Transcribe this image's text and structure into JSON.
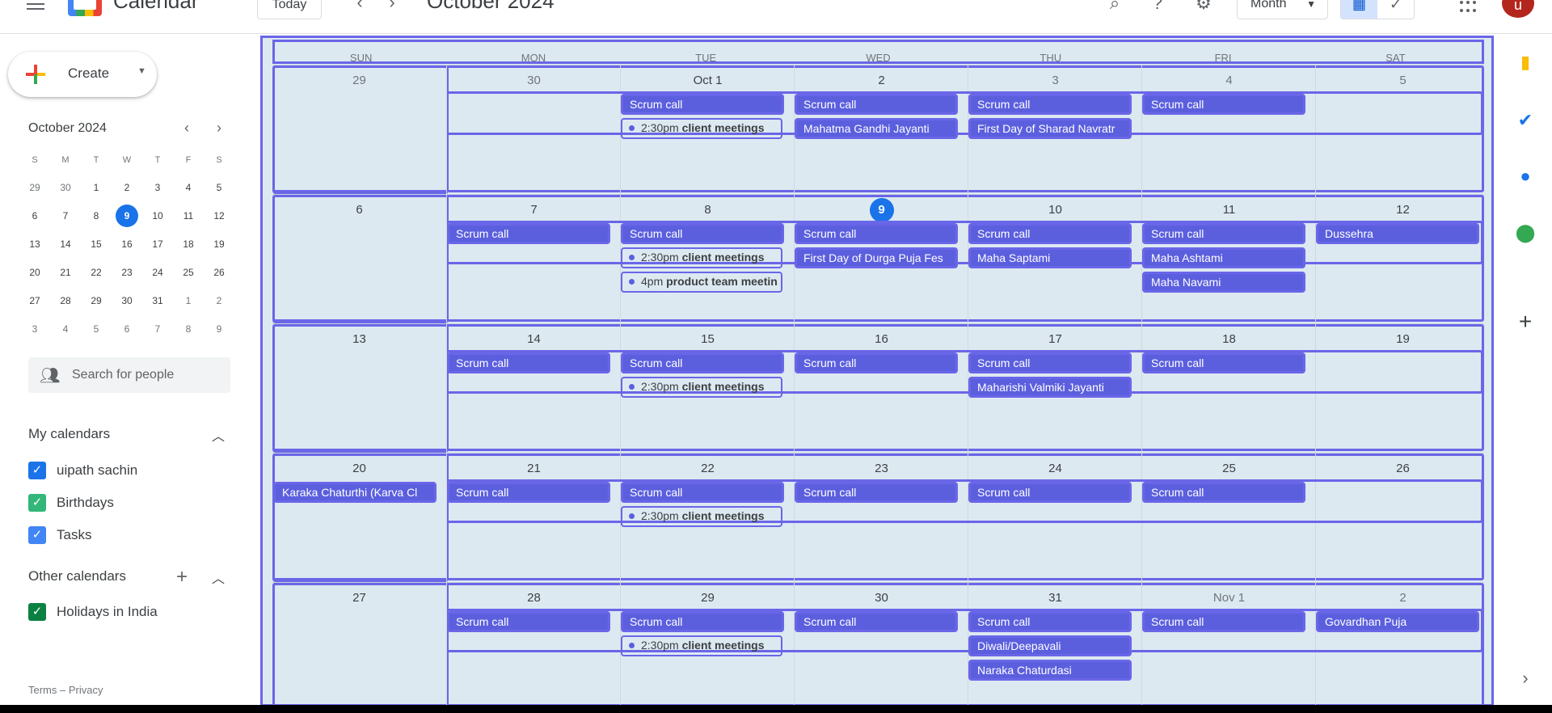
{
  "app": {
    "title": "Calendar"
  },
  "header": {
    "today_label": "Today",
    "month_title": "October 2024",
    "view_select": "Month",
    "avatar_letter": "u"
  },
  "sidebar": {
    "create_label": "Create",
    "mini_calendar": {
      "title": "October 2024",
      "weekday_initials": [
        "S",
        "M",
        "T",
        "W",
        "T",
        "F",
        "S"
      ],
      "weeks": [
        [
          "29",
          "30",
          "1",
          "2",
          "3",
          "4",
          "5"
        ],
        [
          "6",
          "7",
          "8",
          "9",
          "10",
          "11",
          "12"
        ],
        [
          "13",
          "14",
          "15",
          "16",
          "17",
          "18",
          "19"
        ],
        [
          "20",
          "21",
          "22",
          "23",
          "24",
          "25",
          "26"
        ],
        [
          "27",
          "28",
          "29",
          "30",
          "31",
          "1",
          "2"
        ],
        [
          "3",
          "4",
          "5",
          "6",
          "7",
          "8",
          "9"
        ]
      ],
      "today": "9"
    },
    "search_people_placeholder": "Search for people",
    "my_calendars_title": "My calendars",
    "my_calendars": [
      {
        "label": "uipath sachin",
        "color": "#1a73e8"
      },
      {
        "label": "Birthdays",
        "color": "#33b679"
      },
      {
        "label": "Tasks",
        "color": "#4285f4"
      }
    ],
    "other_calendars_title": "Other calendars",
    "other_calendars": [
      {
        "label": "Holidays in India",
        "color": "#0b8043"
      }
    ],
    "footer": "Terms – Privacy"
  },
  "grid": {
    "weekday_headers": [
      "SUN",
      "MON",
      "TUE",
      "WED",
      "THU",
      "FRI",
      "SAT"
    ],
    "event_color": "#5b5fde",
    "weeks": [
      {
        "days": [
          "29",
          "30",
          "Oct 1",
          "2",
          "3",
          "4",
          "5"
        ],
        "gray": [
          0,
          1,
          4,
          5,
          6
        ],
        "events": [
          {
            "col": 2,
            "row": 0,
            "text": "Scrum call",
            "kind": "pill"
          },
          {
            "col": 3,
            "row": 0,
            "text": "Scrum call",
            "kind": "pill"
          },
          {
            "col": 4,
            "row": 0,
            "text": "Scrum call",
            "kind": "pill"
          },
          {
            "col": 5,
            "row": 0,
            "text": "Scrum call",
            "kind": "pill"
          },
          {
            "col": 2,
            "row": 1,
            "time": "2:30pm",
            "title": "client meetings",
            "kind": "timed"
          },
          {
            "col": 3,
            "row": 1,
            "text": "Mahatma Gandhi Jayanti",
            "kind": "pill"
          },
          {
            "col": 4,
            "row": 1,
            "text": "First Day of Sharad Navratr",
            "kind": "pill"
          }
        ]
      },
      {
        "days": [
          "6",
          "7",
          "8",
          "9",
          "10",
          "11",
          "12"
        ],
        "today_col": 3,
        "events": [
          {
            "col": 1,
            "row": 0,
            "text": "Scrum call",
            "kind": "pill"
          },
          {
            "col": 2,
            "row": 0,
            "text": "Scrum call",
            "kind": "pill"
          },
          {
            "col": 3,
            "row": 0,
            "text": "Scrum call",
            "kind": "pill"
          },
          {
            "col": 4,
            "row": 0,
            "text": "Scrum call",
            "kind": "pill"
          },
          {
            "col": 5,
            "row": 0,
            "text": "Scrum call",
            "kind": "pill"
          },
          {
            "col": 6,
            "row": 0,
            "text": "Dussehra",
            "kind": "pill"
          },
          {
            "col": 2,
            "row": 1,
            "time": "2:30pm",
            "title": "client meetings",
            "kind": "timed"
          },
          {
            "col": 3,
            "row": 1,
            "text": "First Day of Durga Puja Fes",
            "kind": "pill"
          },
          {
            "col": 4,
            "row": 1,
            "text": "Maha Saptami",
            "kind": "pill"
          },
          {
            "col": 5,
            "row": 1,
            "text": "Maha Ashtami",
            "kind": "pill"
          },
          {
            "col": 2,
            "row": 2,
            "time": "4pm",
            "title": "product team meetin",
            "kind": "timed"
          },
          {
            "col": 5,
            "row": 2,
            "text": "Maha Navami",
            "kind": "pill"
          }
        ]
      },
      {
        "days": [
          "13",
          "14",
          "15",
          "16",
          "17",
          "18",
          "19"
        ],
        "events": [
          {
            "col": 1,
            "row": 0,
            "text": "Scrum call",
            "kind": "pill"
          },
          {
            "col": 2,
            "row": 0,
            "text": "Scrum call",
            "kind": "pill"
          },
          {
            "col": 3,
            "row": 0,
            "text": "Scrum call",
            "kind": "pill"
          },
          {
            "col": 4,
            "row": 0,
            "text": "Scrum call",
            "kind": "pill"
          },
          {
            "col": 5,
            "row": 0,
            "text": "Scrum call",
            "kind": "pill"
          },
          {
            "col": 2,
            "row": 1,
            "time": "2:30pm",
            "title": "client meetings",
            "kind": "timed"
          },
          {
            "col": 4,
            "row": 1,
            "text": "Maharishi Valmiki Jayanti",
            "kind": "pill"
          }
        ]
      },
      {
        "days": [
          "20",
          "21",
          "22",
          "23",
          "24",
          "25",
          "26"
        ],
        "events": [
          {
            "col": 0,
            "row": 0,
            "text": "Karaka Chaturthi (Karva Cl",
            "kind": "pill"
          },
          {
            "col": 1,
            "row": 0,
            "text": "Scrum call",
            "kind": "pill"
          },
          {
            "col": 2,
            "row": 0,
            "text": "Scrum call",
            "kind": "pill"
          },
          {
            "col": 3,
            "row": 0,
            "text": "Scrum call",
            "kind": "pill"
          },
          {
            "col": 4,
            "row": 0,
            "text": "Scrum call",
            "kind": "pill"
          },
          {
            "col": 5,
            "row": 0,
            "text": "Scrum call",
            "kind": "pill"
          },
          {
            "col": 2,
            "row": 1,
            "time": "2:30pm",
            "title": "client meetings",
            "kind": "timed"
          }
        ]
      },
      {
        "days": [
          "27",
          "28",
          "29",
          "30",
          "31",
          "Nov 1",
          "2"
        ],
        "gray": [
          5,
          6
        ],
        "events": [
          {
            "col": 1,
            "row": 0,
            "text": "Scrum call",
            "kind": "pill"
          },
          {
            "col": 2,
            "row": 0,
            "text": "Scrum call",
            "kind": "pill"
          },
          {
            "col": 3,
            "row": 0,
            "text": "Scrum call",
            "kind": "pill"
          },
          {
            "col": 4,
            "row": 0,
            "text": "Scrum call",
            "kind": "pill"
          },
          {
            "col": 5,
            "row": 0,
            "text": "Scrum call",
            "kind": "pill"
          },
          {
            "col": 6,
            "row": 0,
            "text": "Govardhan Puja",
            "kind": "pill"
          },
          {
            "col": 2,
            "row": 1,
            "time": "2:30pm",
            "title": "client meetings",
            "kind": "timed"
          },
          {
            "col": 4,
            "row": 1,
            "text": "Diwali/Deepavali",
            "kind": "pill"
          },
          {
            "col": 4,
            "row": 2,
            "text": "Naraka Chaturdasi",
            "kind": "pill"
          }
        ]
      }
    ]
  }
}
